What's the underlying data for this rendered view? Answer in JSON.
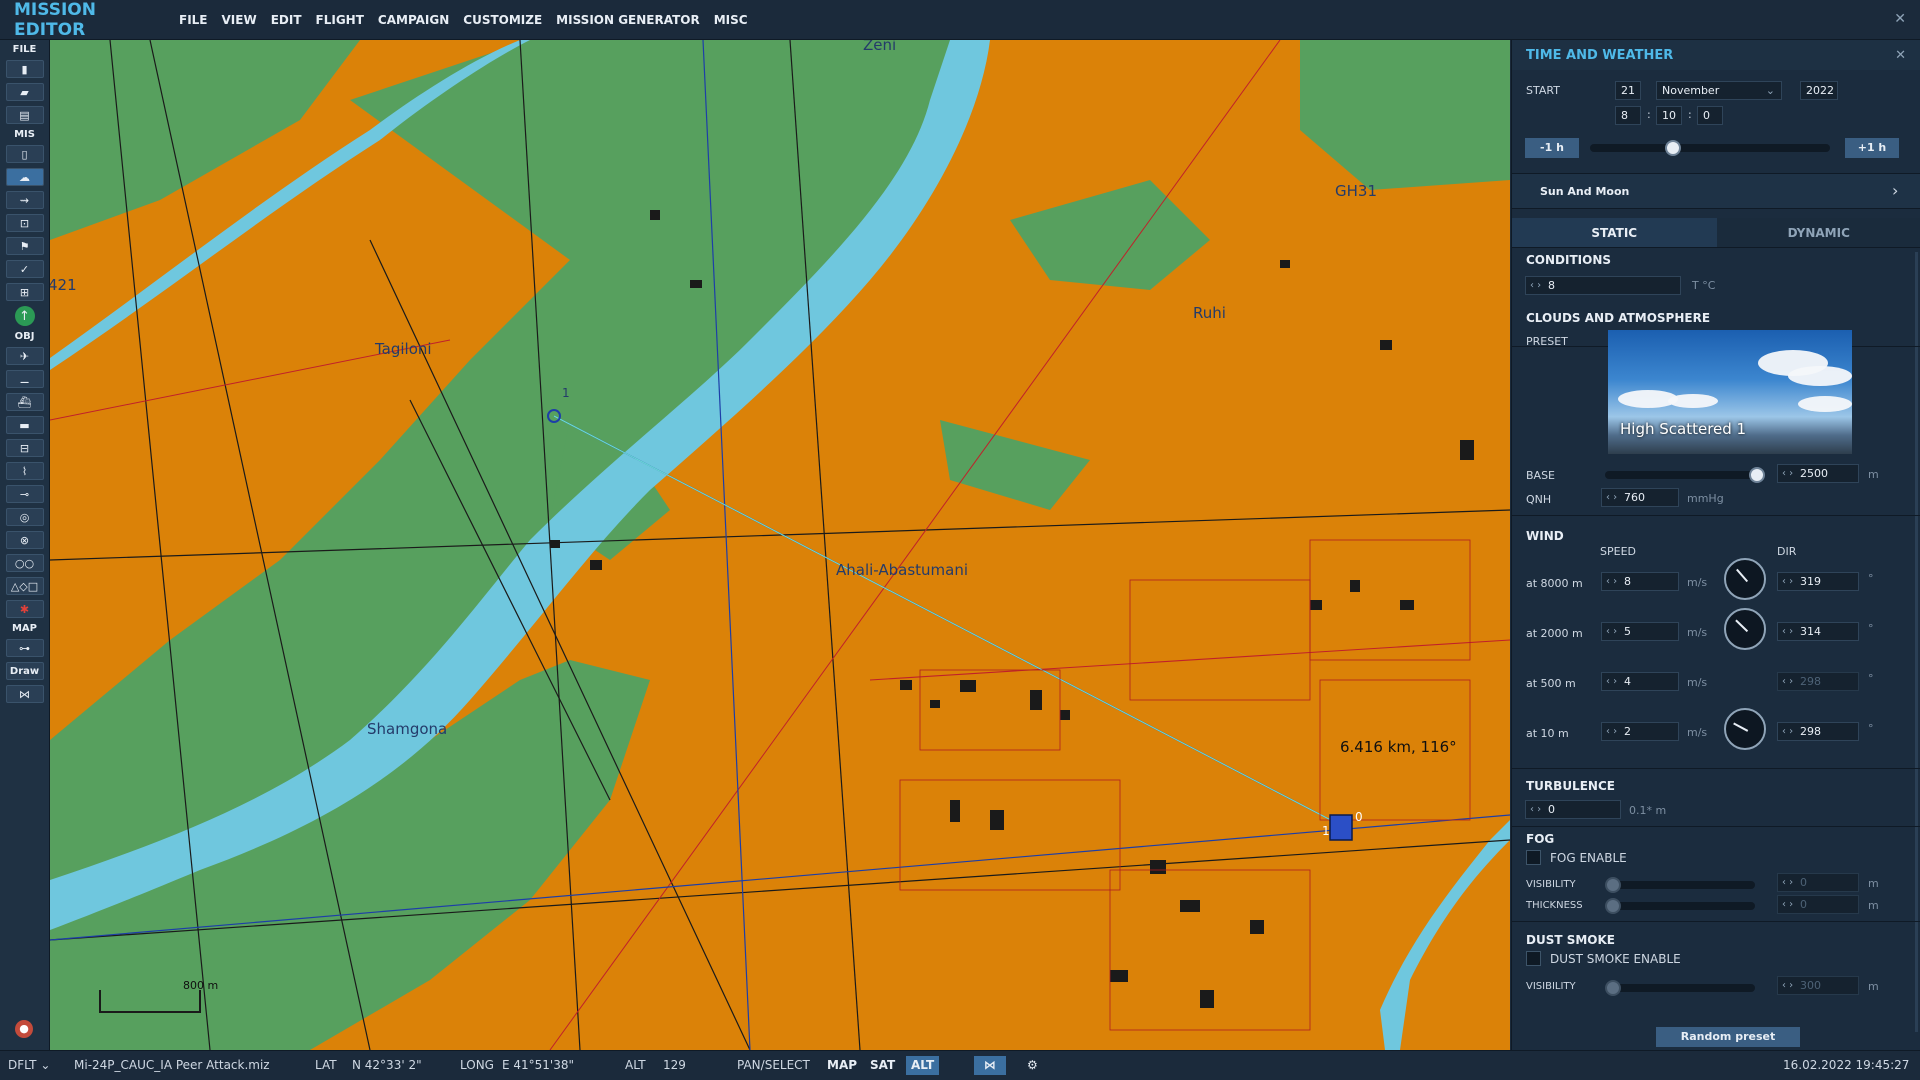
{
  "app": {
    "title": "MISSION EDITOR",
    "menu": [
      "FILE",
      "VIEW",
      "EDIT",
      "FLIGHT",
      "CAMPAIGN",
      "CUSTOMIZE",
      "MISSION GENERATOR",
      "MISC"
    ]
  },
  "left_toolbar": {
    "file_label": "FILE",
    "mis_label": "MIS",
    "obj_label": "OBJ",
    "map_label": "MAP",
    "draw_label": "Draw",
    "icons": [
      "new-file-icon",
      "open-folder-icon",
      "save-icon",
      "briefing-icon",
      "weather-icon",
      "goals-icon",
      "triggers-icon",
      "flag-icon",
      "check-icon",
      "resources-icon",
      "go-arrow-icon",
      "plane-icon",
      "helicopter-icon",
      "ship-icon",
      "vehicle-icon",
      "static-icon",
      "airfield-icon",
      "waypoint-icon",
      "target-icon",
      "zone-icon",
      "chain-icon",
      "shapes-icon",
      "destroy-icon",
      "ruler-icon",
      "link-icon"
    ]
  },
  "map": {
    "labels": [
      "Zeni",
      "GH31",
      "Ruhi",
      "Tagiloni",
      "Ahali-Abastumani",
      "Shamgona",
      "421"
    ],
    "measure_label": "6.416 km, 116°",
    "waypoint_label": "1",
    "unit_label_a": "1",
    "unit_label_b": "0",
    "scale": "800 m"
  },
  "panel": {
    "title": "TIME AND WEATHER",
    "start_label": "START",
    "day": "21",
    "month": "November",
    "year": "2022",
    "hour": "8",
    "minute": "10",
    "second": "0",
    "minus_hour": "-1 h",
    "plus_hour": "+1 h",
    "time_slider_fraction": 0.35,
    "sun_moon": "Sun And Moon",
    "tabs": [
      "STATIC",
      "DYNAMIC"
    ],
    "conditions_label": "CONDITIONS",
    "temperature": "8",
    "temperature_unit": "T °C",
    "clouds_label": "CLOUDS AND ATMOSPHERE",
    "preset_label": "PRESET",
    "preset_name": "High Scattered 1",
    "base_label": "BASE",
    "base_value": "2500",
    "base_unit": "m",
    "base_slider_fraction": 0.95,
    "qnh_label": "QNH",
    "qnh_value": "760",
    "qnh_unit": "mmHg",
    "wind_label": "WIND",
    "speed_header": "SPEED",
    "dir_header": "DIR",
    "wind_rows": [
      {
        "alt": "at 8000 m",
        "speed": "8",
        "unit": "m/s",
        "dir": "319",
        "deg": "°",
        "dial_deg": 319
      },
      {
        "alt": "at 2000 m",
        "speed": "5",
        "unit": "m/s",
        "dir": "314",
        "deg": "°",
        "dial_deg": 314
      },
      {
        "alt": "at 500 m",
        "speed": "4",
        "unit": "m/s",
        "dir": "298",
        "deg": "°",
        "dial_deg": 298
      },
      {
        "alt": "at 10 m",
        "speed": "2",
        "unit": "m/s",
        "dir": "298",
        "deg": "°",
        "dial_deg": 298
      }
    ],
    "turbulence_label": "TURBULENCE",
    "turbulence_value": "0",
    "turbulence_unit": "0.1* m",
    "fog_label": "FOG",
    "fog_enable": "FOG ENABLE",
    "visibility_label": "VISIBILITY",
    "thickness_label": "THICKNESS",
    "fog_visibility": "0",
    "fog_thickness": "0",
    "m_unit": "m",
    "dust_label": "DUST SMOKE",
    "dust_enable": "DUST SMOKE ENABLE",
    "dust_visibility": "300",
    "random_preset": "Random preset"
  },
  "status": {
    "layer": "DFLT",
    "file": "Mi-24P_CAUC_IA Peer Attack.miz",
    "lat_label": "LAT",
    "lat": "N 42°33' 2\"",
    "long_label": "LONG",
    "long": "E 41°51'38\"",
    "alt_label": "ALT",
    "alt": "129",
    "pan_select": "PAN/SELECT",
    "map_btn": "MAP",
    "sat_btn": "SAT",
    "alt_btn": "ALT",
    "datetime": "16.02.2022 19:45:27"
  },
  "colors": {
    "accent": "#4fb9e8",
    "map_orange": "#db8208",
    "map_green": "#57a05e",
    "river": "#6fc7de",
    "panel_bg": "#1b2c3e"
  }
}
